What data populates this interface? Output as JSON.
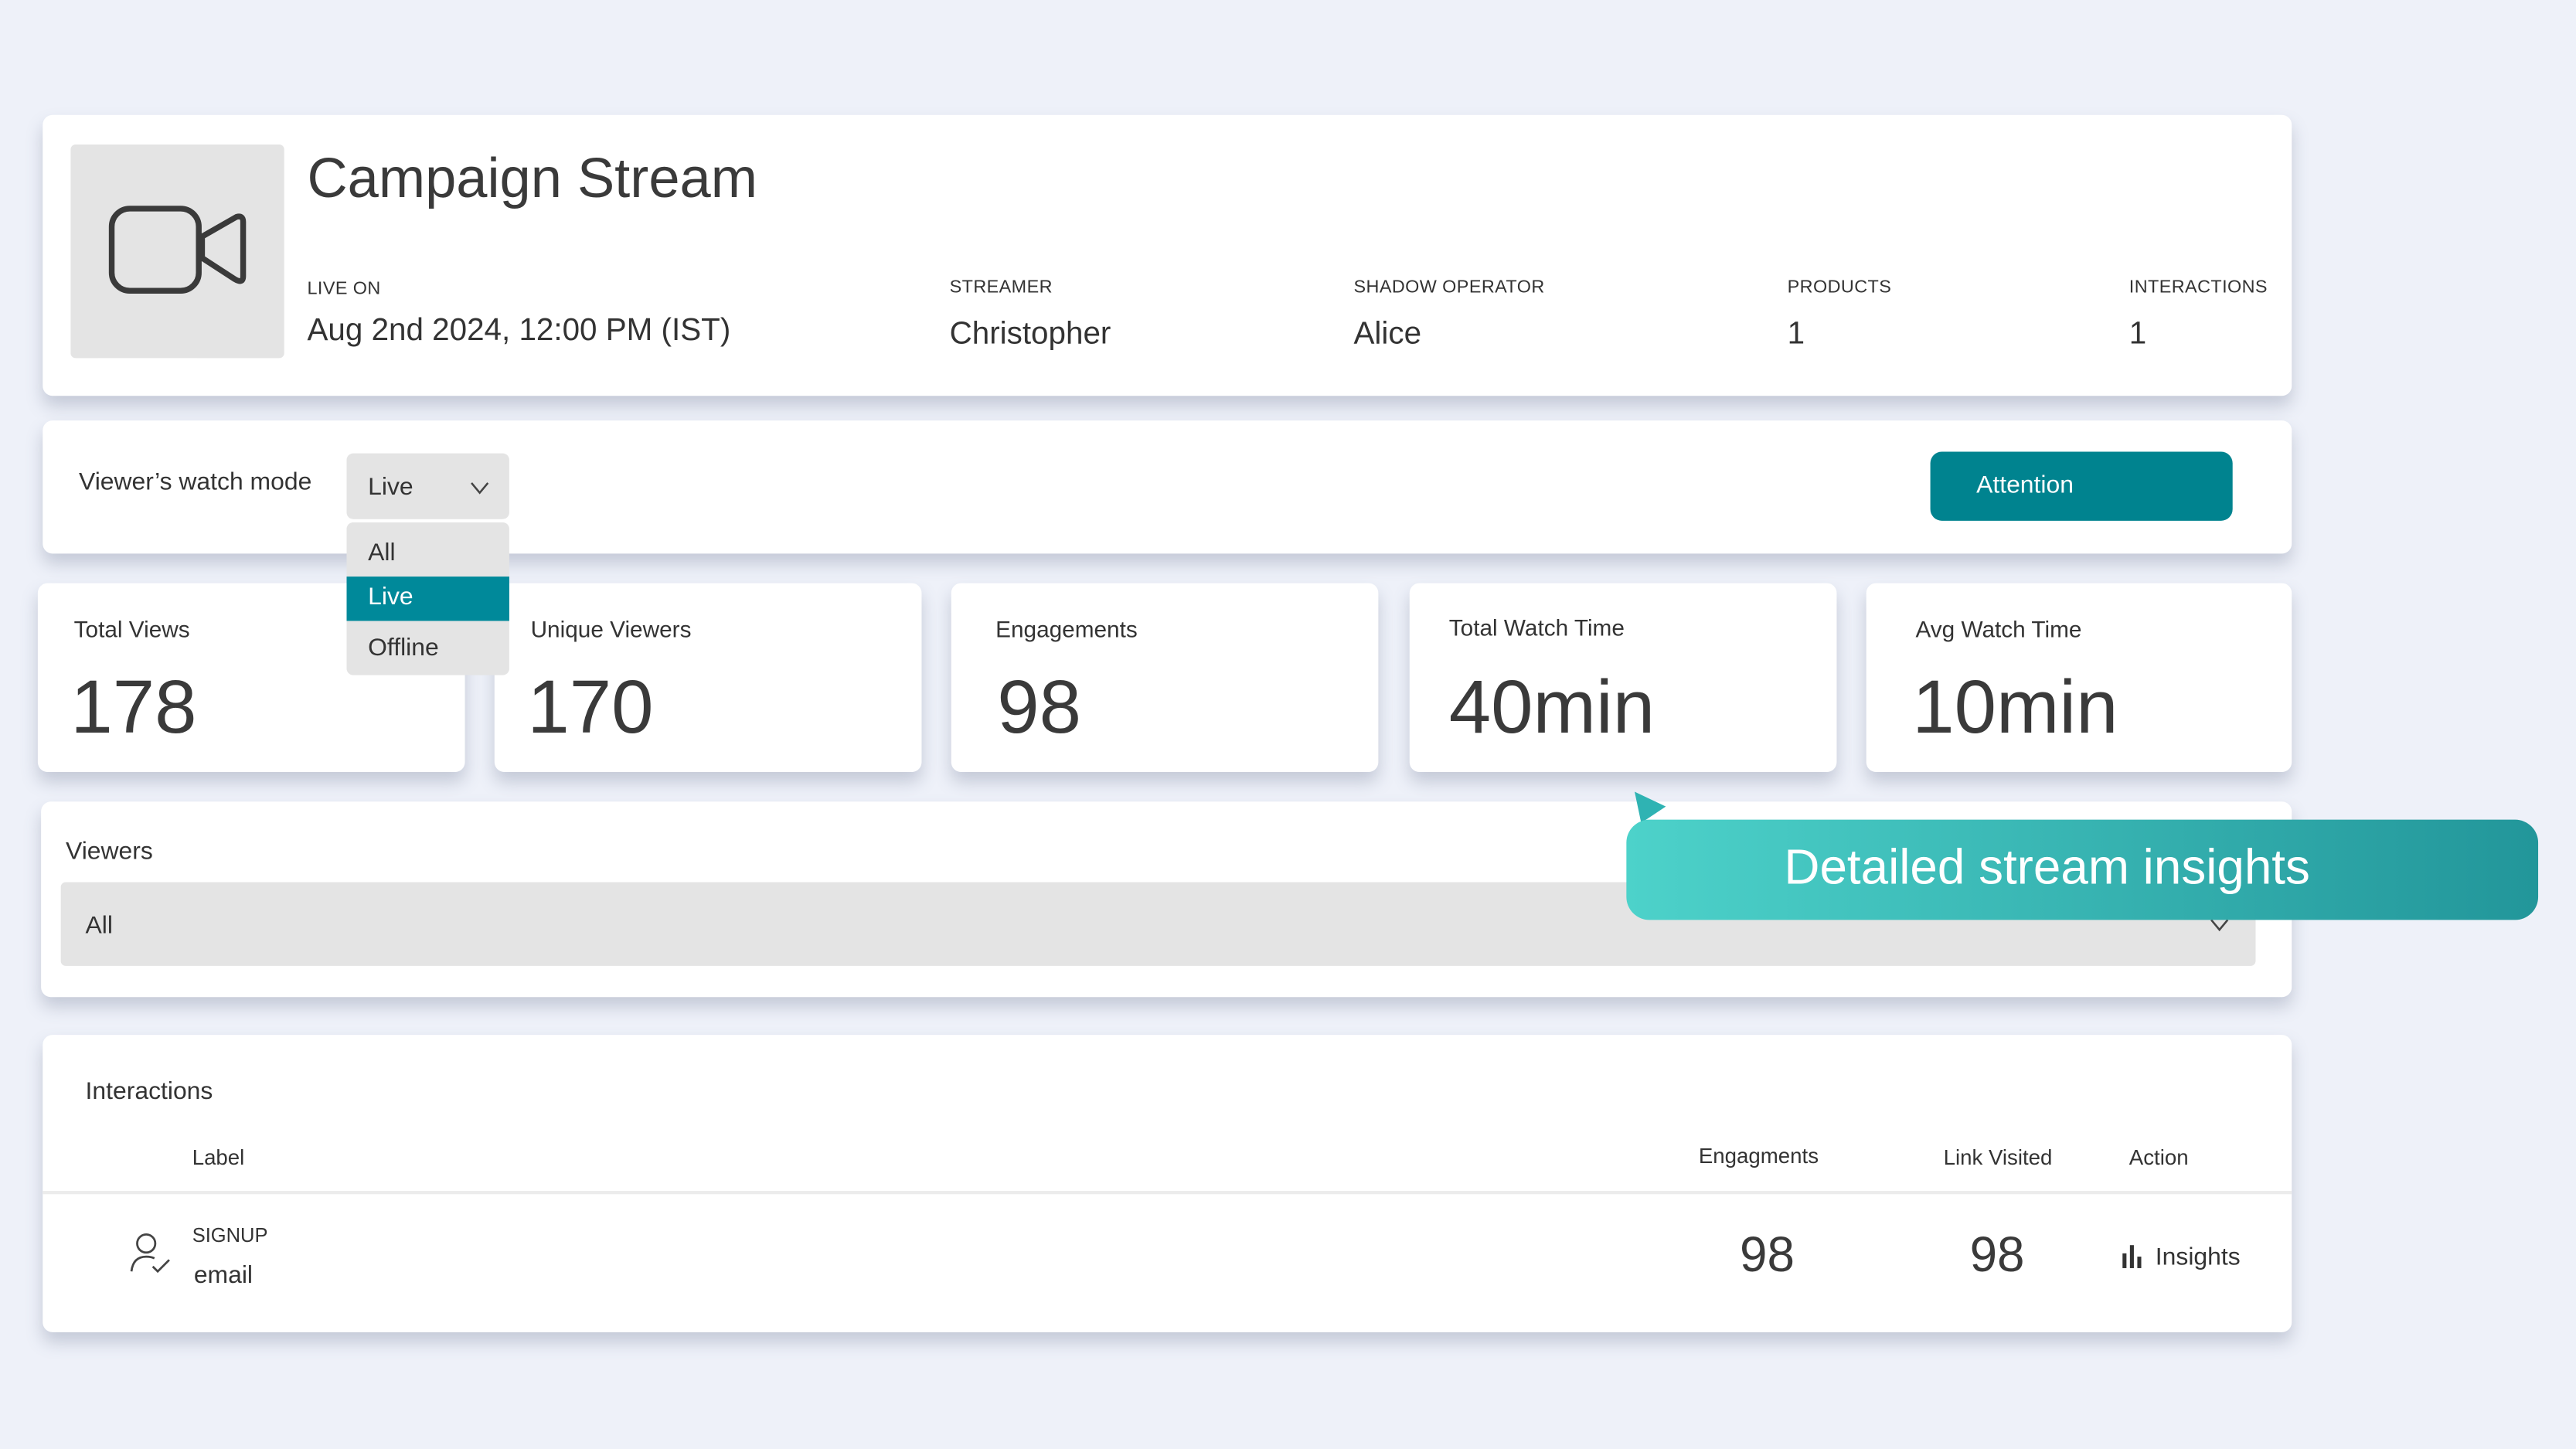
{
  "header": {
    "title": "Campaign Stream",
    "thumbnail_icon": "video-camera-icon",
    "fields": [
      {
        "label": "LIVE ON",
        "value": "Aug 2nd 2024, 12:00 PM (IST)"
      },
      {
        "label": "STREAMER",
        "value": "Christopher"
      },
      {
        "label": "SHADOW OPERATOR",
        "value": "Alice"
      },
      {
        "label": "PRODUCTS",
        "value": "1"
      },
      {
        "label": "INTERACTIONS",
        "value": "1"
      }
    ]
  },
  "watch_mode": {
    "label": "Viewer’s watch mode",
    "selected": "Live",
    "options": [
      "All",
      "Live",
      "Offline"
    ],
    "attention_label": "Attention"
  },
  "stats": [
    {
      "label": "Total Views",
      "value": "178"
    },
    {
      "label": "Unique Viewers",
      "value": "170"
    },
    {
      "label": "Engagements",
      "value": "98"
    },
    {
      "label": "Total Watch Time",
      "value": "40min"
    },
    {
      "label": "Avg Watch Time",
      "value": "10min"
    }
  ],
  "viewers": {
    "label": "Viewers",
    "selected": "All"
  },
  "callout": {
    "text": "Detailed stream insights"
  },
  "interactions": {
    "title": "Interactions",
    "columns": [
      "Label",
      "Engagments",
      "Link Visited",
      "Action"
    ],
    "rows": [
      {
        "type": "SIGNUP",
        "label": "email",
        "engagements": "98",
        "link_visited": "98",
        "action": "Insights"
      }
    ]
  },
  "colors": {
    "accent": "#00899a",
    "callout_start": "#4dd2ca",
    "callout_end": "#22969a",
    "background": "#eef1f9"
  }
}
